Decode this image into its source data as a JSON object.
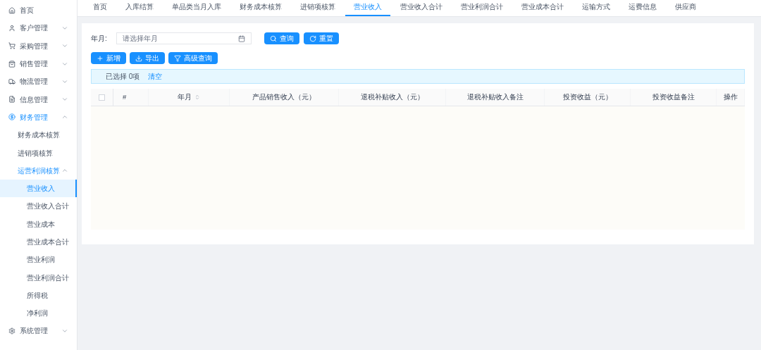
{
  "sidebar": {
    "items": [
      {
        "label": "首页",
        "selected": false
      },
      {
        "label": "客户管理",
        "expanded": false,
        "selected": false
      },
      {
        "label": "采购管理",
        "expanded": false,
        "selected": false
      },
      {
        "label": "销售管理",
        "expanded": false,
        "selected": false
      },
      {
        "label": "物流管理",
        "expanded": false,
        "selected": false
      },
      {
        "label": "信息管理",
        "expanded": false,
        "selected": false
      },
      {
        "label": "财务管理",
        "expanded": true,
        "selected": true,
        "children": [
          {
            "label": "财务成本核算",
            "selected": false
          },
          {
            "label": "进销项核算",
            "selected": false
          },
          {
            "label": "运营利润核算",
            "expanded": true,
            "selected": true,
            "children": [
              {
                "label": "营业收入",
                "selected": true
              },
              {
                "label": "营业收入合计",
                "selected": false
              },
              {
                "label": "营业成本",
                "selected": false
              },
              {
                "label": "营业成本合计",
                "selected": false
              },
              {
                "label": "营业利润",
                "selected": false
              },
              {
                "label": "营业利润合计",
                "selected": false
              },
              {
                "label": "所得税",
                "selected": false
              },
              {
                "label": "净利润",
                "selected": false
              }
            ]
          }
        ]
      },
      {
        "label": "系统管理",
        "expanded": false,
        "selected": false
      }
    ]
  },
  "tabs": [
    {
      "label": "首页",
      "selected": false
    },
    {
      "label": "入库结算",
      "selected": false
    },
    {
      "label": "单品类当月入库",
      "selected": false
    },
    {
      "label": "财务成本核算",
      "selected": false
    },
    {
      "label": "进销项核算",
      "selected": false
    },
    {
      "label": "营业收入",
      "selected": true
    },
    {
      "label": "营业收入合计",
      "selected": false
    },
    {
      "label": "营业利润合计",
      "selected": false
    },
    {
      "label": "营业成本合计",
      "selected": false
    },
    {
      "label": "运输方式",
      "selected": false
    },
    {
      "label": "运费信息",
      "selected": false
    },
    {
      "label": "供应商",
      "selected": false
    }
  ],
  "search": {
    "label": "年月:",
    "placeholder": "请选择年月",
    "buttons": [
      "查询",
      "重置"
    ]
  },
  "toolbar": [
    "新增",
    "导出",
    "高级查询"
  ],
  "selection": {
    "text": "已选择 0项",
    "clear": "清空"
  },
  "table": {
    "select_all": false,
    "columns": [
      {
        "label": "#",
        "sortable": false
      },
      {
        "label": "年月",
        "sortable": true
      },
      {
        "label": "产品销售收入（元）",
        "sortable": false
      },
      {
        "label": "退税补贴收入（元）",
        "sortable": false
      },
      {
        "label": "退税补贴收入备注",
        "sortable": false
      },
      {
        "label": "投资收益（元）",
        "sortable": false
      },
      {
        "label": "投资收益备注",
        "sortable": false
      },
      {
        "label": "操作",
        "sortable": false
      }
    ]
  }
}
